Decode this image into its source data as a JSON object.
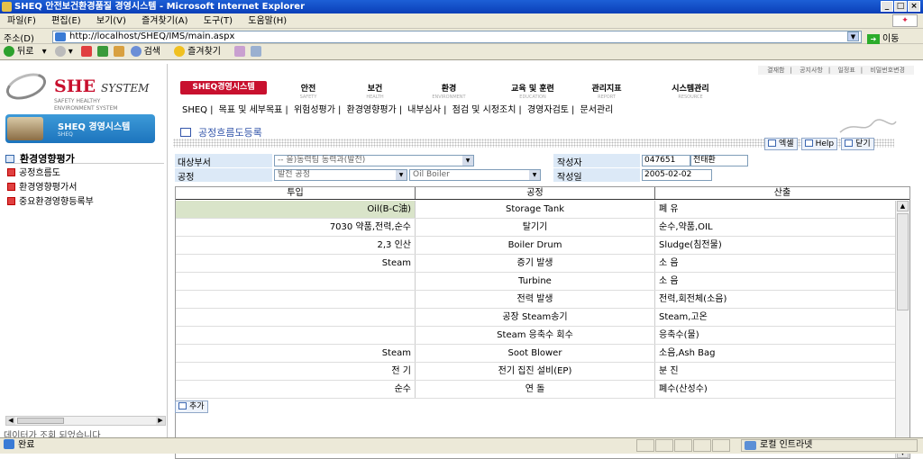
{
  "window": {
    "title": "SHEQ 안전보건환경품질 경영시스템 - Microsoft Internet Explorer",
    "controls": [
      "_",
      "□",
      "×"
    ]
  },
  "menu": [
    "파일(F)",
    "편집(E)",
    "보기(V)",
    "즐겨찾기(A)",
    "도구(T)",
    "도움말(H)"
  ],
  "address": {
    "label": "주소(D)",
    "url": "http://localhost/SHEQ/IMS/main.aspx",
    "go": "이동"
  },
  "toolbar": {
    "back": "뒤로",
    "search": "검색",
    "favorites": "즐겨찾기"
  },
  "logo": {
    "she": "SHE",
    "system": "SYSTEM",
    "tag1": "SAFETY  HEALTHY",
    "tag2": "ENVIRONMENT  SYSTEM"
  },
  "sheq_box": {
    "title": "SHEQ 경영시스템",
    "sub": "SHEQ"
  },
  "sidebar": {
    "section": "환경영향평가",
    "items": [
      "공정흐름도",
      "환경영향평가서",
      "중요환경영향등록부"
    ],
    "message": "데이터가 조회 되었습니다"
  },
  "top_links": [
    "결재함",
    "공지사항",
    "일정표",
    "비밀번호변경"
  ],
  "main_button": "SHEQ경영시스템",
  "tabs": [
    {
      "ko": "안전",
      "en": "SAFETY"
    },
    {
      "ko": "보건",
      "en": "HEALTH"
    },
    {
      "ko": "환경",
      "en": "ENVIRONMENT"
    },
    {
      "ko": "교육 및 훈련",
      "en": "EDUCATION"
    },
    {
      "ko": "관리지표",
      "en": "REPORT"
    },
    {
      "ko": "시스템관리",
      "en": "RESOURCE"
    }
  ],
  "subnav": [
    "SHEQ",
    "|",
    "목표 및 세부목표",
    "|",
    "위험성평가",
    "|",
    "환경영향평가",
    "|",
    "내부심사",
    "|",
    "점검 및 시정조치",
    "|",
    "경영자검토",
    "|",
    "문서관리"
  ],
  "page_title": "공정흐름도등록",
  "actions": {
    "excel": "엑셀",
    "help": "Help",
    "close": "닫기"
  },
  "form": {
    "dept_label": "대상부서",
    "dept_value": "-- 을)동력팀 동력과(발전)",
    "author_label": "작성자",
    "author_id": "047651",
    "author_name": "전태환",
    "process_label": "공정",
    "process_value": "발전 공정",
    "process_value2": "Oil Boiler",
    "date_label": "작성일",
    "date_value": "2005-02-02"
  },
  "grid": {
    "headers": [
      "투입",
      "공정",
      "산출"
    ],
    "rows": [
      [
        "Oil(B-C油)",
        "Storage Tank",
        "폐 유"
      ],
      [
        "7030 약품,전력,순수",
        "탈기기",
        "순수,약품,OIL"
      ],
      [
        "2,3 인산",
        "Boiler Drum",
        "Sludge(침전물)"
      ],
      [
        "Steam",
        "증기 발생",
        "소 음"
      ],
      [
        "",
        "Turbine",
        "소 음"
      ],
      [
        "",
        "전력 발생",
        "전력,회전체(소음)"
      ],
      [
        "",
        "공장 Steam송기",
        "Steam,고온"
      ],
      [
        "",
        "Steam 응축수 회수",
        "응축수(물)"
      ],
      [
        "Steam",
        "Soot Blower",
        "소음,Ash Bag"
      ],
      [
        "전 기",
        "전기 집진 설비(EP)",
        "분 진"
      ],
      [
        "순수",
        "연 돌",
        "폐수(산성수)"
      ]
    ]
  },
  "add_button": "추가",
  "status": {
    "text": "완료",
    "zone": "로컬 인트라넷"
  }
}
